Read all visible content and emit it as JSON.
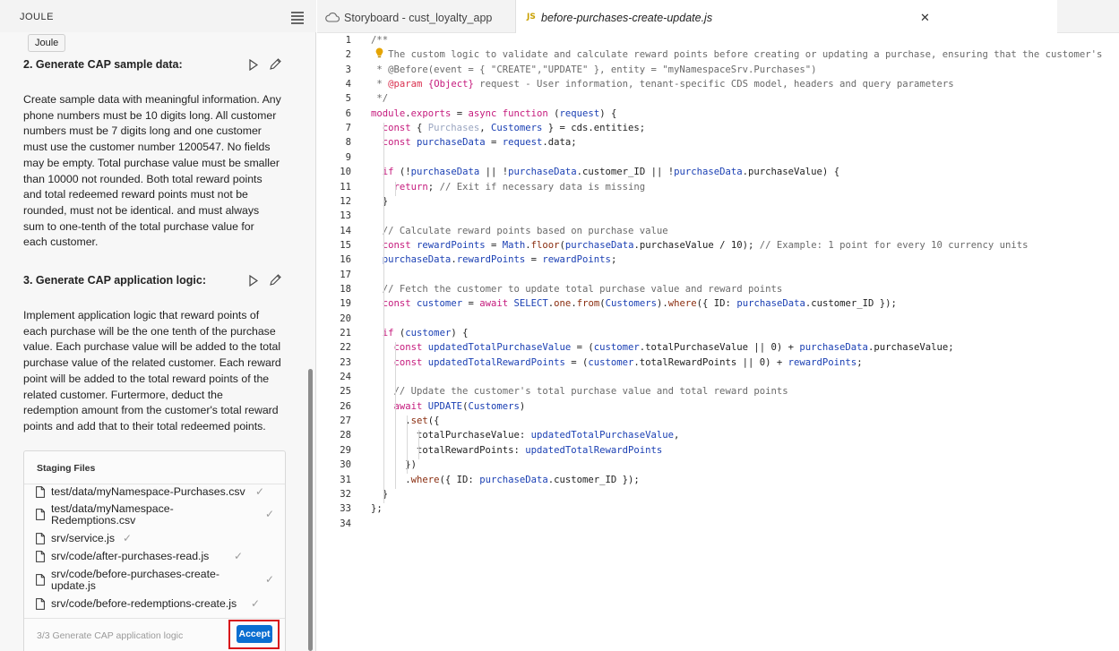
{
  "joule": {
    "title": "JOULE",
    "tooltip": "Joule",
    "steps": [
      {
        "title": "2. Generate CAP sample data:",
        "lines": [
          "Create sample data with meaningful information. Any",
          "phone numbers must be 10 digits long. All customer",
          "numbers must be 7 digits long and one customer",
          "must use the customer number 1200547. No fields",
          "may be empty. Total purchase value must be smaller",
          "than 10000 not rounded. Both total reward points",
          "and total redeemed reward points must not be",
          "rounded, must not be identical. and must always",
          "sum to one-tenth of the total purchase value for",
          "each customer."
        ]
      },
      {
        "title": "3. Generate CAP application logic:",
        "lines": [
          "Implement application logic that reward points of",
          "each purchase will be the one tenth of the purchase",
          "value. Each purchase value will be added to the total",
          "purchase value of the related customer. Each reward",
          "point will be added to the total reward points of the",
          "related customer. Furtermore, deduct the",
          "redemption amount from the customer's total reward",
          "points and add that to their total redeemed points."
        ]
      }
    ],
    "staging": {
      "title": "Staging Files",
      "files": [
        {
          "name": "test/data/myNamespace-Purchases.csv",
          "status": "✓"
        },
        {
          "name": "test/data/myNamespace-Redemptions.csv",
          "status": "✓"
        },
        {
          "name": "srv/service.js",
          "status": "✓"
        },
        {
          "name": "srv/code/after-purchases-read.js",
          "status": "✓"
        },
        {
          "name": "srv/code/before-purchases-create-update.js",
          "status": "✓"
        },
        {
          "name": "srv/code/before-redemptions-create.js",
          "status": "✓"
        }
      ],
      "progress": "3/3 Generate CAP application logic",
      "accept_label": "Accept"
    }
  },
  "editor": {
    "tabs": [
      {
        "label": "Storyboard - cust_loyalty_app",
        "icon": "cloud-icon"
      },
      {
        "label": "before-purchases-create-update.js",
        "icon": "js-file-icon",
        "badge": "JS",
        "active": true
      }
    ],
    "code_lines": [
      "/**",
      "   The custom logic to validate and calculate reward points before creating or updating a purchase, ensuring that the customer's",
      " * @Before(event = { \"CREATE\",\"UPDATE\" }, entity = \"myNamespaceSrv.Purchases\")",
      " * @param {Object} request - User information, tenant-specific CDS model, headers and query parameters",
      " */",
      "module.exports = async function (request) {",
      "  const { Purchases, Customers } = cds.entities;",
      "  const purchaseData = request.data;",
      "",
      "  if (!purchaseData || !purchaseData.customer_ID || !purchaseData.purchaseValue) {",
      "    return; // Exit if necessary data is missing",
      "  }",
      "",
      "  // Calculate reward points based on purchase value",
      "  const rewardPoints = Math.floor(purchaseData.purchaseValue / 10); // Example: 1 point for every 10 currency units",
      "  purchaseData.rewardPoints = rewardPoints;",
      "",
      "  // Fetch the customer to update total purchase value and reward points",
      "  const customer = await SELECT.one.from(Customers).where({ ID: purchaseData.customer_ID });",
      "",
      "  if (customer) {",
      "    const updatedTotalPurchaseValue = (customer.totalPurchaseValue || 0) + purchaseData.purchaseValue;",
      "    const updatedTotalRewardPoints = (customer.totalRewardPoints || 0) + rewardPoints;",
      "",
      "    // Update the customer's total purchase value and total reward points",
      "    await UPDATE(Customers)",
      "      .set({",
      "        totalPurchaseValue: updatedTotalPurchaseValue,",
      "        totalRewardPoints: updatedTotalRewardPoints",
      "      })",
      "      .where({ ID: purchaseData.customer_ID });",
      "  }",
      "};",
      ""
    ]
  }
}
